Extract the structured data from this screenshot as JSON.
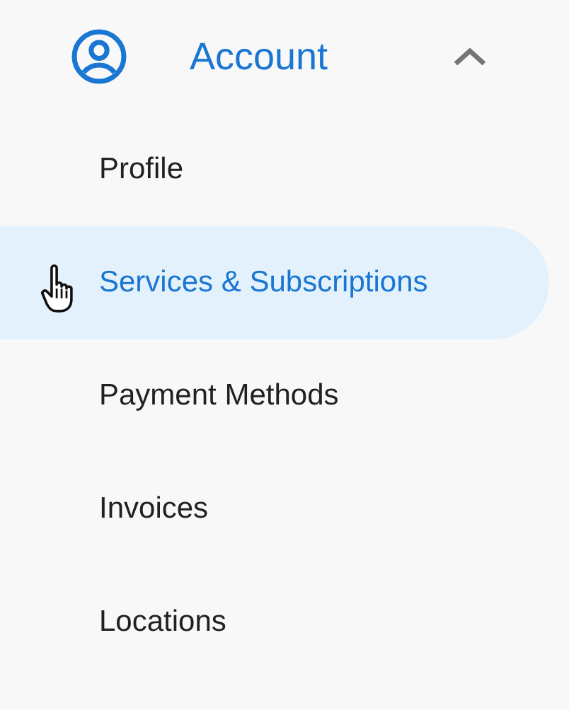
{
  "section": {
    "title": "Account",
    "expanded": true
  },
  "items": [
    {
      "label": "Profile",
      "selected": false
    },
    {
      "label": "Services & Subscriptions",
      "selected": true
    },
    {
      "label": "Payment Methods",
      "selected": false
    },
    {
      "label": "Invoices",
      "selected": false
    },
    {
      "label": "Locations",
      "selected": false
    }
  ]
}
